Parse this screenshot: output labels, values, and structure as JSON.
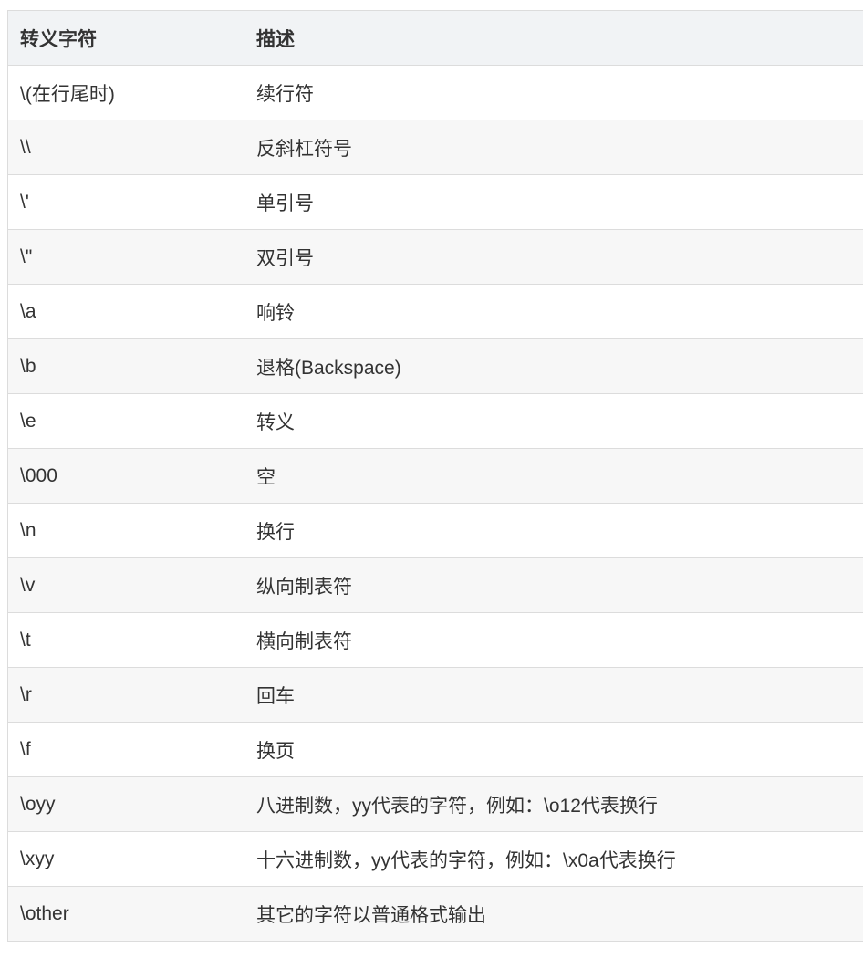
{
  "table": {
    "headers": [
      "转义字符",
      "描述"
    ],
    "rows": [
      [
        "\\(在行尾时)",
        "续行符"
      ],
      [
        "\\\\",
        "反斜杠符号"
      ],
      [
        "\\'",
        "单引号"
      ],
      [
        "\\\"",
        "双引号"
      ],
      [
        "\\a",
        "响铃"
      ],
      [
        "\\b",
        "退格(Backspace)"
      ],
      [
        "\\e",
        "转义"
      ],
      [
        "\\000",
        "空"
      ],
      [
        "\\n",
        "换行"
      ],
      [
        "\\v",
        "纵向制表符"
      ],
      [
        "\\t",
        "横向制表符"
      ],
      [
        "\\r",
        "回车"
      ],
      [
        "\\f",
        "换页"
      ],
      [
        "\\oyy",
        "八进制数，yy代表的字符，例如：\\o12代表换行"
      ],
      [
        "\\xyy",
        "十六进制数，yy代表的字符，例如：\\x0a代表换行"
      ],
      [
        "\\other",
        "其它的字符以普通格式输出"
      ]
    ]
  }
}
